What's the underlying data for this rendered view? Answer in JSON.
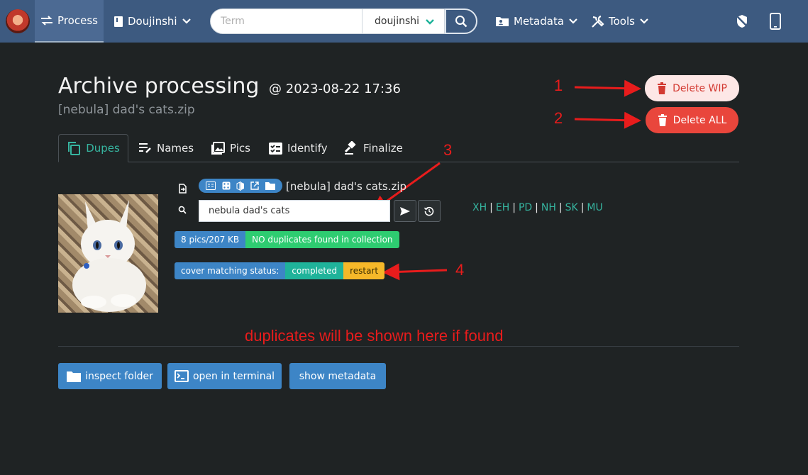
{
  "navbar": {
    "process_label": "Process",
    "category_label": "Doujinshi",
    "search": {
      "placeholder": "Term",
      "value": "",
      "namespace_value": "doujinshi"
    },
    "metadata_label": "Metadata",
    "tools_label": "Tools"
  },
  "header": {
    "title": "Archive processing",
    "date": "@ 2023-08-22 17:36",
    "subtitle": "[nebula] dad's cats.zip",
    "delete_wip_label": "Delete WIP",
    "delete_all_label": "Delete ALL"
  },
  "annotations": {
    "a1": "1",
    "a2": "2",
    "a3": "3",
    "a4": "4",
    "duplicates_note": "duplicates will be shown here if found",
    "color": "#e81c1c"
  },
  "tabs": [
    {
      "label": "Dupes",
      "icon": "copy-icon",
      "active": true
    },
    {
      "label": "Names",
      "icon": "edit-list-icon"
    },
    {
      "label": "Pics",
      "icon": "images-icon"
    },
    {
      "label": "Identify",
      "icon": "check-list-icon"
    },
    {
      "label": "Finalize",
      "icon": "gavel-icon"
    }
  ],
  "content": {
    "archive_name": "[nebula] dad's cats.zip",
    "search_name_value": "nebula dad's cats",
    "site_links": [
      "XH",
      "EH",
      "PD",
      "NH",
      "SK",
      "MU"
    ],
    "stats": {
      "pics_size": "8 pics/207 KB",
      "dupes_status": "NO duplicates found in collection"
    },
    "cover_matching": {
      "label": "cover matching status:",
      "status": "completed",
      "restart_label": "restart"
    }
  },
  "actions": {
    "inspect_label": "inspect folder",
    "terminal_label": "open in terminal",
    "metadata_label": "show metadata"
  },
  "colors": {
    "navbar": "#3d5a80",
    "background": "#1f2324",
    "accent_teal": "#36b5a0",
    "button_blue": "#3d85c6",
    "danger": "#e9463c"
  }
}
